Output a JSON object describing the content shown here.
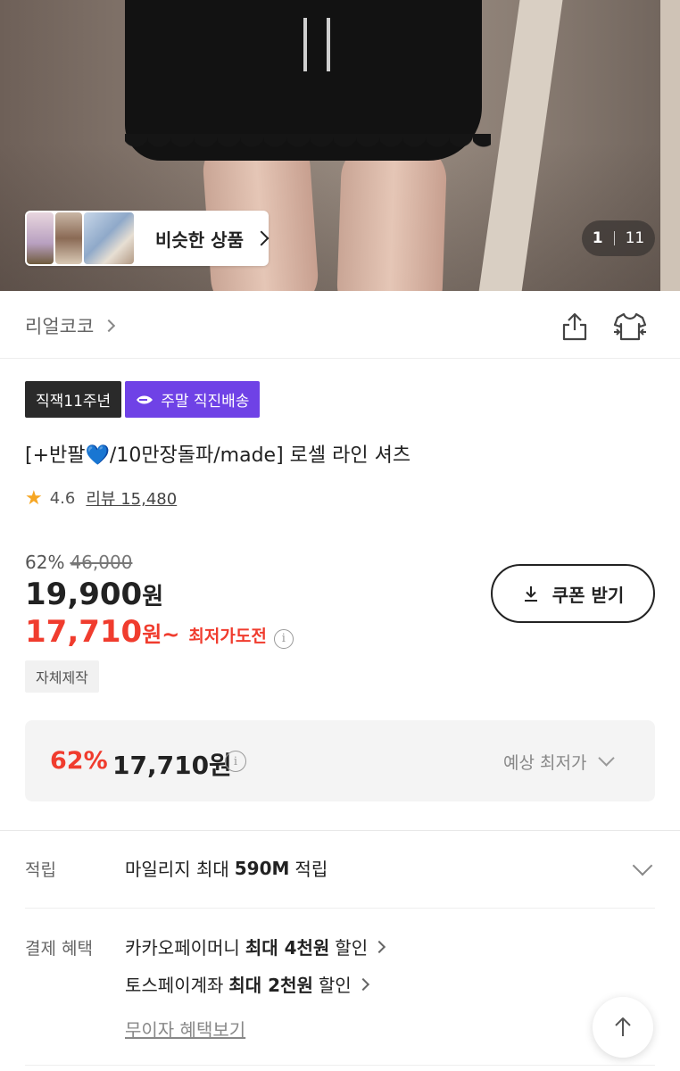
{
  "hero": {
    "similar_label": "비슷한 상품",
    "counter_current": "1",
    "counter_total": "11"
  },
  "shop": {
    "name": "리얼코코",
    "share_icon": "share-icon",
    "shirt_icon": "shirt-icon"
  },
  "badges": [
    "직잭11주년",
    "주말 직진배송"
  ],
  "product": {
    "title_prefix": "[+반팔",
    "title_heart": "💙",
    "title_suffix": "/10만장돌파/made] 로셀 라인 셔츠",
    "rating": "4.6",
    "review_label": "리뷰 15,480"
  },
  "price": {
    "discount": "62%",
    "original": "46,000",
    "price": "19,900",
    "won": "원",
    "sale_price": "17,710",
    "sale_won": "원~",
    "sale_tag": "최저가도전",
    "coupon_label": "쿠폰 받기",
    "self_made": "자체제작"
  },
  "lowest": {
    "discount": "62%",
    "amount": "17,710원",
    "expected_label": "예상 최저가"
  },
  "points": {
    "label": "적립",
    "text_prefix": "마일리지 최대",
    "text_bold": "590M",
    "text_suffix": "적립"
  },
  "payment": {
    "label": "결제 혜택",
    "items": [
      {
        "prefix": "카카오페이머니",
        "bold": "최대 4천원",
        "suffix": "할인"
      },
      {
        "prefix": "토스페이계좌",
        "bold": "최대 2천원",
        "suffix": "할인"
      }
    ],
    "more": "무이자 혜택보기"
  },
  "colors": {
    "accent_red": "#f03c2e",
    "badge_purple": "#6f42e6",
    "star": "#f6a623"
  }
}
